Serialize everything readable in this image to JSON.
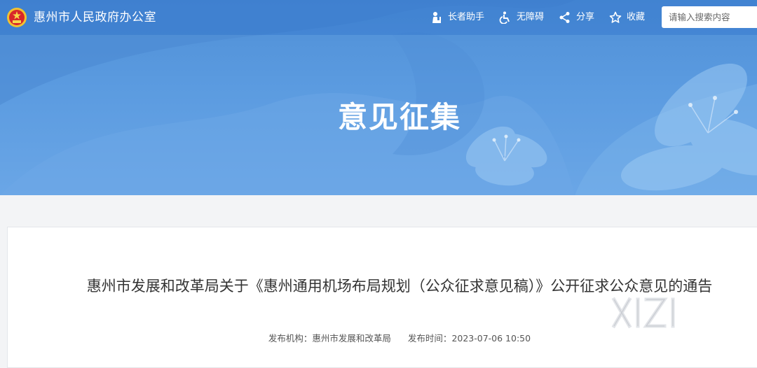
{
  "header": {
    "site_title": "惠州市人民政府办公室",
    "tools": [
      {
        "label": "长者助手",
        "icon": "elder-assist-icon"
      },
      {
        "label": "无障碍",
        "icon": "accessibility-icon"
      },
      {
        "label": "分享",
        "icon": "share-icon"
      },
      {
        "label": "收藏",
        "icon": "star-icon"
      }
    ],
    "search_placeholder": "请输入搜索内容"
  },
  "banner": {
    "title": "意见征集"
  },
  "article": {
    "title": "惠州市发展和改革局关于《惠州通用机场布局规划（公众征求意见稿）》公开征求公众意见的通告",
    "publisher_label": "发布机构：",
    "publisher": "惠州市发展和改革局",
    "time_label": "发布时间：",
    "time": "2023-07-06 10:50"
  },
  "colors": {
    "banner_blue": "#5b9be0",
    "text": "#333333"
  }
}
